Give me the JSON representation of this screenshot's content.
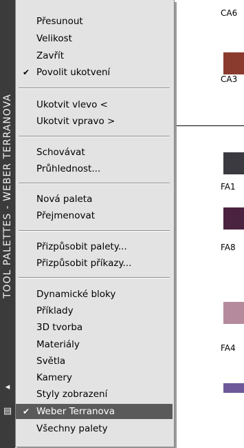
{
  "palette": {
    "title": "TOOL PALETTES - WEBER TERRANOVA",
    "labels": [
      "CA6",
      "CA3",
      "FA1",
      "FA8",
      "FA4"
    ],
    "swatch_colors": [
      "#8b3a2e",
      "#3a3a40",
      "#4a2340",
      "#b58a9c",
      "#6e5a9a"
    ]
  },
  "menu": {
    "items": [
      {
        "label": "Přesunout",
        "checked": false,
        "selected": false
      },
      {
        "label": "Velikost",
        "checked": false,
        "selected": false
      },
      {
        "label": "Zavřít",
        "checked": false,
        "selected": false
      },
      {
        "label": "Povolit ukotvení",
        "checked": true,
        "selected": false
      },
      {
        "label": "Ukotvit vlevo  <",
        "checked": false,
        "selected": false
      },
      {
        "label": "Ukotvit vpravo  >",
        "checked": false,
        "selected": false
      },
      {
        "label": "Schovávat",
        "checked": false,
        "selected": false
      },
      {
        "label": "Průhlednost...",
        "checked": false,
        "selected": false
      },
      {
        "label": "Nová paleta",
        "checked": false,
        "selected": false
      },
      {
        "label": "Přejmenovat",
        "checked": false,
        "selected": false
      },
      {
        "label": "Přizpůsobit palety...",
        "checked": false,
        "selected": false
      },
      {
        "label": "Přizpůsobit příkazy...",
        "checked": false,
        "selected": false
      },
      {
        "label": "Dynamické bloky",
        "checked": false,
        "selected": false
      },
      {
        "label": "Příklady",
        "checked": false,
        "selected": false
      },
      {
        "label": "3D tvorba",
        "checked": false,
        "selected": false
      },
      {
        "label": "Materiály",
        "checked": false,
        "selected": false
      },
      {
        "label": "Světla",
        "checked": false,
        "selected": false
      },
      {
        "label": "Kamery",
        "checked": false,
        "selected": false
      },
      {
        "label": "Styly zobrazení",
        "checked": false,
        "selected": false
      },
      {
        "label": "Weber Terranova",
        "checked": true,
        "selected": true
      },
      {
        "label": "Všechny palety",
        "checked": false,
        "selected": false
      }
    ],
    "check_glyph": "✔"
  }
}
